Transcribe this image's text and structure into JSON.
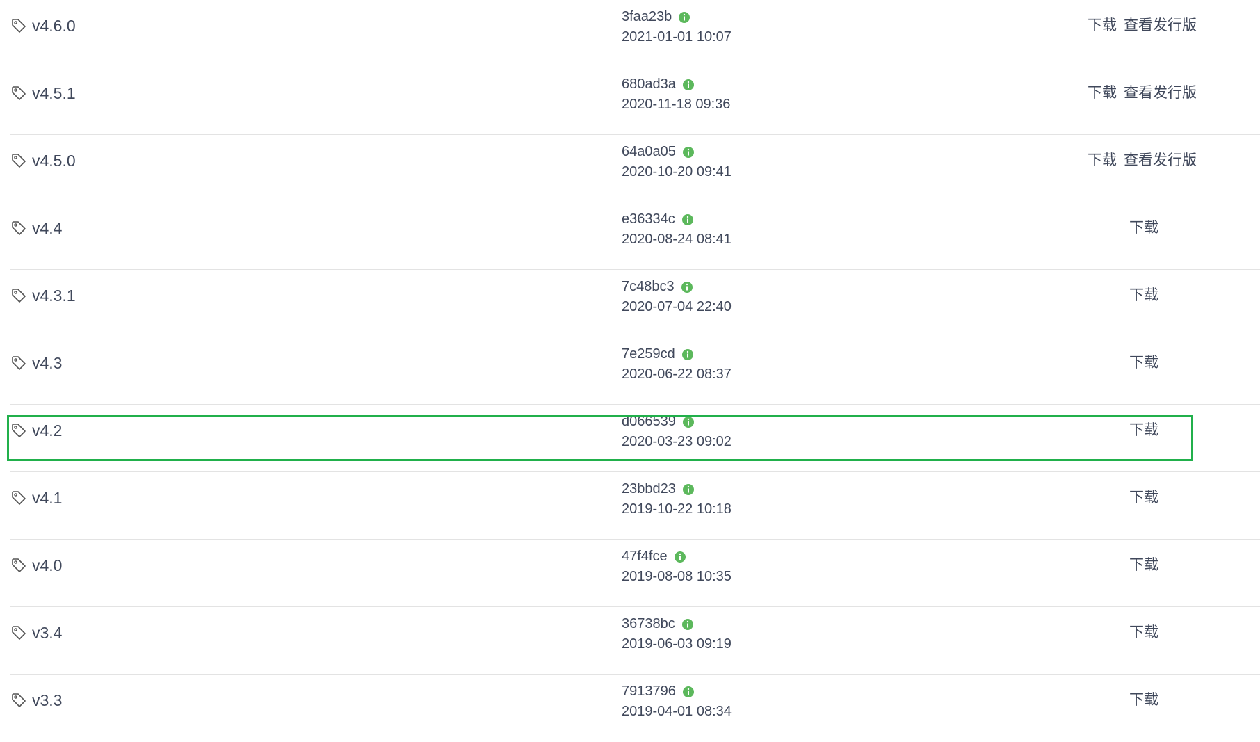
{
  "highlight_color": "#21b04b",
  "info_icon_color": "#5cb85c",
  "icons": {
    "tag": "tag-icon",
    "info": "info-icon"
  },
  "tags": [
    {
      "name": "v4.6.0",
      "sha": "3faa23b",
      "date": "2021-01-01 10:07",
      "download": "下载",
      "release": "查看发行版"
    },
    {
      "name": "v4.5.1",
      "sha": "680ad3a",
      "date": "2020-11-18 09:36",
      "download": "下载",
      "release": "查看发行版"
    },
    {
      "name": "v4.5.0",
      "sha": "64a0a05",
      "date": "2020-10-20 09:41",
      "download": "下载",
      "release": "查看发行版"
    },
    {
      "name": "v4.4",
      "sha": "e36334c",
      "date": "2020-08-24 08:41",
      "download": "下载"
    },
    {
      "name": "v4.3.1",
      "sha": "7c48bc3",
      "date": "2020-07-04 22:40",
      "download": "下载"
    },
    {
      "name": "v4.3",
      "sha": "7e259cd",
      "date": "2020-06-22 08:37",
      "download": "下载"
    },
    {
      "name": "v4.2",
      "sha": "d066539",
      "date": "2020-03-23 09:02",
      "download": "下载",
      "highlighted": true
    },
    {
      "name": "v4.1",
      "sha": "23bbd23",
      "date": "2019-10-22 10:18",
      "download": "下载"
    },
    {
      "name": "v4.0",
      "sha": "47f4fce",
      "date": "2019-08-08 10:35",
      "download": "下载"
    },
    {
      "name": "v3.4",
      "sha": "36738bc",
      "date": "2019-06-03 09:19",
      "download": "下载"
    },
    {
      "name": "v3.3",
      "sha": "7913796",
      "date": "2019-04-01 08:34",
      "download": "下载"
    }
  ]
}
